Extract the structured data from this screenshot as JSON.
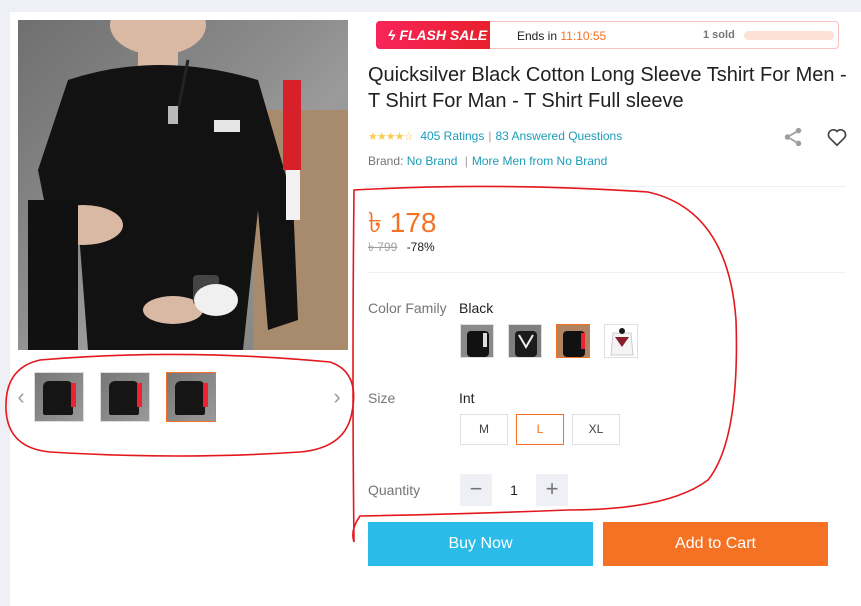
{
  "flash_sale": {
    "badge_label": "FLASH SALE",
    "ends_label": "Ends in",
    "time_left": "11:10:55",
    "sold_label": "1 sold"
  },
  "product": {
    "title": "Quicksilver Black Cotton Long Sleeve Tshirt For Men - T Shirt For Man - T Shirt Full sleeve",
    "rating_stars": 4,
    "ratings_text": "405 Ratings",
    "answered_text": "83 Answered Questions",
    "brand_label": "Brand:",
    "brand_name": "No Brand",
    "more_from": "More Men from No Brand"
  },
  "price": {
    "current": "৳ 178",
    "original": "৳ 799",
    "discount": "-78%"
  },
  "variations": {
    "color_label": "Color Family",
    "color_value": "Black",
    "size_label": "Size",
    "size_value": "Int",
    "sizes": [
      "M",
      "L",
      "XL"
    ],
    "selected_size": "L"
  },
  "quantity": {
    "label": "Quantity",
    "value": "1",
    "minus": "−",
    "plus": "+"
  },
  "actions": {
    "buy_now": "Buy Now",
    "add_to_cart": "Add to Cart"
  },
  "gallery": {
    "prev": "‹",
    "next": "›"
  },
  "colors": {
    "accent": "#f57224",
    "buy_now": "#2abbe8",
    "link": "#1a9cb7",
    "annotation": "#e3181d"
  }
}
